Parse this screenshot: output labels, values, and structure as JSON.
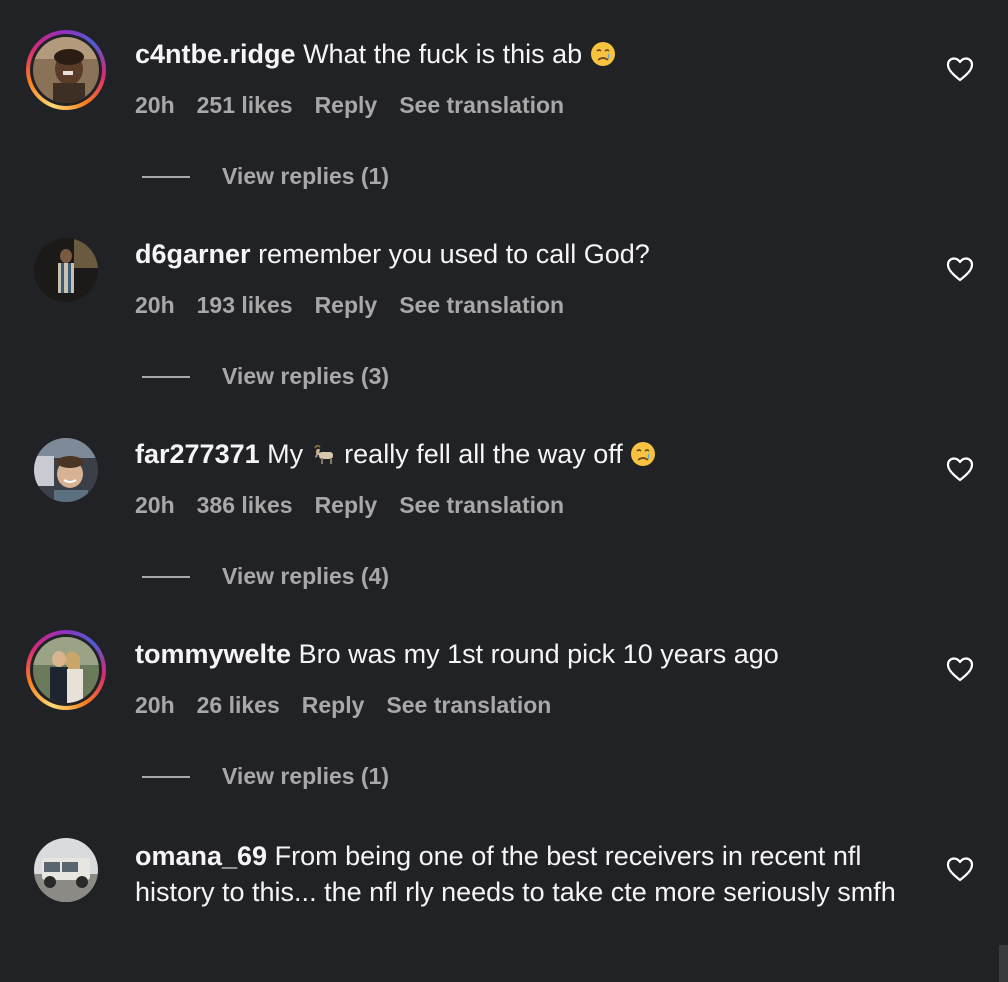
{
  "comments": [
    {
      "username": "c4ntbe.ridge",
      "text": "What the fuck is this ab",
      "emoji": "crying-face",
      "time": "20h",
      "likes": "251 likes",
      "reply": "Reply",
      "translate": "See translation",
      "view_replies": "View replies (1)",
      "story_ring": true
    },
    {
      "username": "d6garner",
      "text": "remember you used to call God?",
      "time": "20h",
      "likes": "193 likes",
      "reply": "Reply",
      "translate": "See translation",
      "view_replies": "View replies (3)",
      "story_ring": false
    },
    {
      "username": "far277371",
      "text_before": "My",
      "emoji_mid": "goat",
      "text_after": "really fell all the way off",
      "emoji": "crying-face",
      "time": "20h",
      "likes": "386 likes",
      "reply": "Reply",
      "translate": "See translation",
      "view_replies": "View replies (4)",
      "story_ring": false
    },
    {
      "username": "tommywelte",
      "text": "Bro was my 1st round pick 10 years ago",
      "time": "20h",
      "likes": "26 likes",
      "reply": "Reply",
      "translate": "See translation",
      "view_replies": "View replies (1)",
      "story_ring": true
    },
    {
      "username": "omana_69",
      "text": "From being one of the best receivers in recent nfl history to this... the nfl rly needs to take cte more seriously smfh",
      "story_ring": false
    }
  ],
  "icons": {
    "like": "heart-outline-icon"
  },
  "colors": {
    "background": "#212226",
    "text": "#f5f5f5",
    "secondary": "#a8a8a8"
  }
}
